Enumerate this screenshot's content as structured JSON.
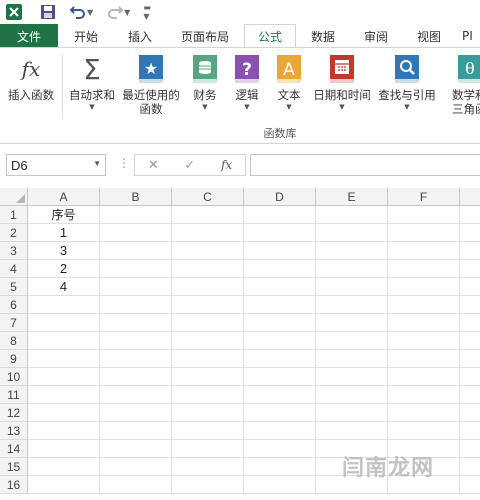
{
  "tabs": [
    "文件",
    "开始",
    "插入",
    "页面布局",
    "公式",
    "数据",
    "审阅",
    "视图",
    "PI"
  ],
  "active_tab": "公式",
  "ribbon": {
    "buttons": [
      {
        "label": "插入函数",
        "icon": "fx-icon"
      },
      {
        "label": "自动求和",
        "icon": "sigma-icon"
      },
      {
        "label": "最近使用的\n函数",
        "icon": "star-book-icon"
      },
      {
        "label": "财务",
        "icon": "finance-book-icon"
      },
      {
        "label": "逻辑",
        "icon": "logic-book-icon"
      },
      {
        "label": "文本",
        "icon": "text-book-icon"
      },
      {
        "label": "日期和时间",
        "icon": "calendar-book-icon"
      },
      {
        "label": "查找与引用",
        "icon": "lookup-book-icon"
      },
      {
        "label": "数学和\n三角函数",
        "icon": "math-book-icon"
      }
    ],
    "group_label": "函数库"
  },
  "formula_bar": {
    "name_box": "D6",
    "fx": "fx",
    "formula": ""
  },
  "grid": {
    "columns": [
      "A",
      "B",
      "C",
      "D",
      "E",
      "F"
    ],
    "rows": [
      "1",
      "2",
      "3",
      "4",
      "5",
      "6",
      "7",
      "8",
      "9",
      "10",
      "11",
      "12",
      "13",
      "14",
      "15",
      "16"
    ],
    "column_a": [
      "序号",
      "1",
      "3",
      "2",
      "4"
    ]
  },
  "watermark": "闫南龙网",
  "colors": {
    "file_tab": "#217346",
    "active_tab_text": "#217346",
    "finance": "#5aa581",
    "logic": "#8c4fb3",
    "text": "#e8a738",
    "datetime": "#c0392b",
    "lookup": "#2f78b7",
    "math": "#3a9c9a",
    "recent": "#2f78b7"
  }
}
